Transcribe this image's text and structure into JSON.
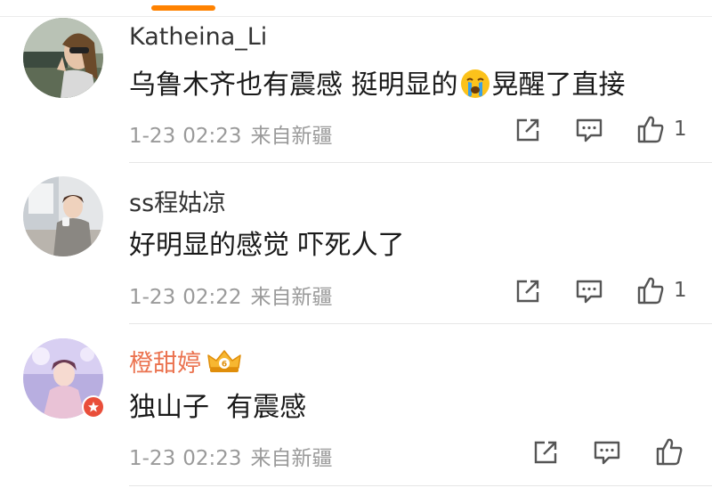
{
  "comments": [
    {
      "username": "Katheina_Li",
      "text_before": "乌鲁木齐也有震感 挺明显的",
      "emoji": "crying-face",
      "text_after": "晃醒了直接",
      "date": "1-23",
      "time": "02:23",
      "source": "来自新疆",
      "likes": "1"
    },
    {
      "username": "ss程姑凉",
      "text": "好明显的感觉 吓死人了",
      "date": "1-23",
      "time": "02:22",
      "source": "来自新疆",
      "likes": "1"
    },
    {
      "username": "橙甜婷",
      "badge": "crown-6",
      "text": "独山子  有震感",
      "date": "1-23",
      "time": "02:23",
      "source": "来自新疆",
      "likes": ""
    }
  ],
  "colors": {
    "accent": "#ff8200",
    "vip_name": "#eb7350",
    "icon": "#555555"
  },
  "icons": [
    "share-icon",
    "reply-icon",
    "like-icon",
    "crying-face-icon",
    "crown-icon",
    "vip-badge-icon"
  ]
}
